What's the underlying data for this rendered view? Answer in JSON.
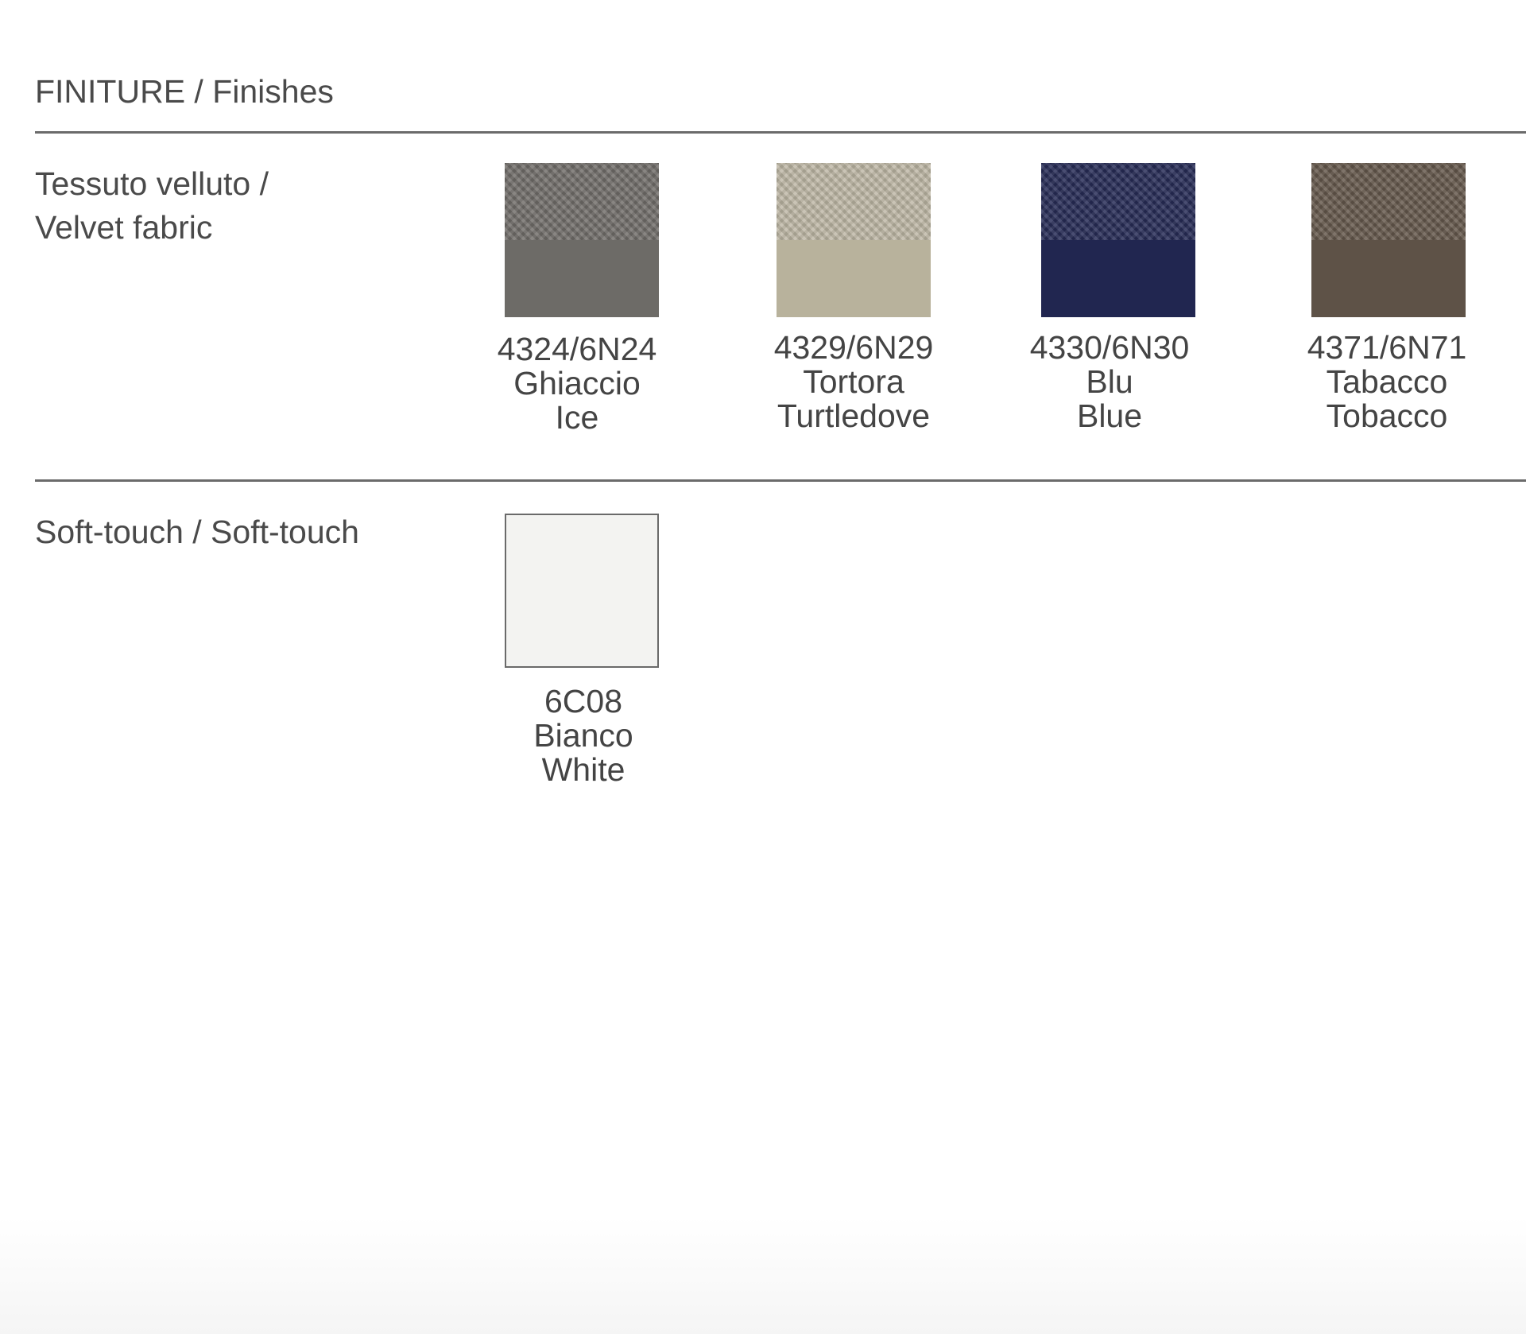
{
  "header": {
    "title": "FINITURE / Finishes"
  },
  "sections": [
    {
      "label_line1": "Tessuto velluto /",
      "label_line2": "Velvet fabric",
      "swatches": [
        {
          "code": "4324/6N24",
          "name_it": "Ghiaccio",
          "name_en": "Ice",
          "color": "#6d6b67",
          "weave_color": "#75726e"
        },
        {
          "code": "4329/6N29",
          "name_it": "Tortora",
          "name_en": "Turtledove",
          "color": "#b8b29c",
          "weave_color": "#c2bcaa"
        },
        {
          "code": "4330/6N30",
          "name_it": "Blu",
          "name_en": "Blue",
          "color": "#212650",
          "weave_color": "#2a2f5a"
        },
        {
          "code": "4371/6N71",
          "name_it": "Tabacco",
          "name_en": "Tobacco",
          "color": "#5e5247",
          "weave_color": "#695c50"
        }
      ]
    },
    {
      "label_line1": "Soft-touch / Soft-touch",
      "swatches": [
        {
          "code": "6C08",
          "name_it": "Bianco",
          "name_en": "White",
          "color": "#f3f3f1"
        }
      ]
    }
  ]
}
